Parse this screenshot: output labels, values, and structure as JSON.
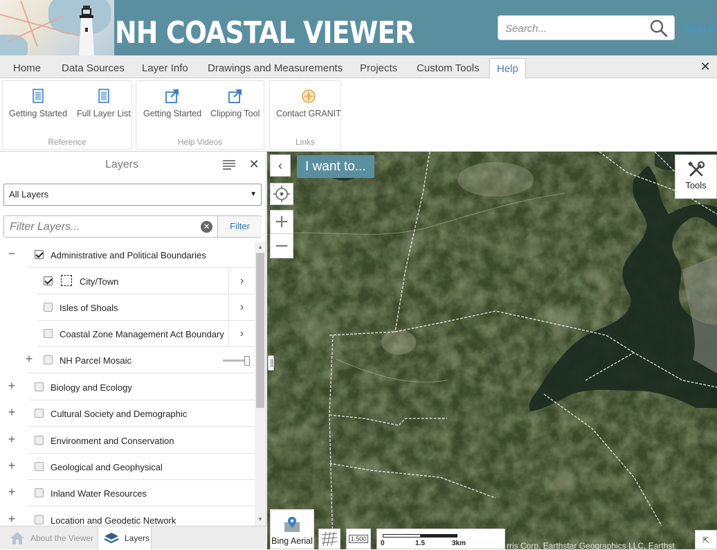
{
  "header": {
    "title": "NH COASTAL VIEWER",
    "search_placeholder": "Search...",
    "sign_in": "Sign in"
  },
  "ribbon": {
    "tabs": [
      {
        "label": "Home",
        "active": false
      },
      {
        "label": "Data Sources",
        "active": false
      },
      {
        "label": "Layer Info",
        "active": false
      },
      {
        "label": "Drawings and Measurements",
        "active": false
      },
      {
        "label": "Projects",
        "active": false
      },
      {
        "label": "Custom Tools",
        "active": false
      },
      {
        "label": "Help",
        "active": true
      }
    ],
    "close_glyph": "✕",
    "groups": [
      {
        "label": "Reference",
        "buttons": [
          {
            "label": "Getting Started",
            "icon": "document-icon"
          },
          {
            "label": "Full Layer List",
            "icon": "document-icon"
          }
        ]
      },
      {
        "label": "Help Videos",
        "buttons": [
          {
            "label": "Getting Started",
            "icon": "external-link-icon"
          },
          {
            "label": "Clipping Tool",
            "icon": "external-link-icon"
          }
        ]
      },
      {
        "label": "Links",
        "buttons": [
          {
            "label": "Contact GRANIT",
            "icon": "compass-icon"
          }
        ]
      }
    ]
  },
  "layers_panel": {
    "title": "Layers",
    "close_glyph": "✕",
    "select_value": "All Layers",
    "select_arrow": "▼",
    "filter_placeholder": "Filter Layers...",
    "filter_clear": "✕",
    "filter_button": "Filter",
    "rows": [
      {
        "label": "Administrative and Political Boundaries",
        "expander": "−",
        "checked": true,
        "level": 0
      },
      {
        "label": "City/Town",
        "checked": true,
        "level": 1,
        "chevron": "›",
        "swatch": true
      },
      {
        "label": "Isles of Shoals",
        "checked": false,
        "level": 1,
        "chevron": "›"
      },
      {
        "label": "Coastal Zone Management Act Boundary",
        "checked": false,
        "level": 1,
        "chevron": "›"
      },
      {
        "label": "NH Parcel Mosaic",
        "expander": "+",
        "checked": false,
        "level": 1,
        "slider": 0.95
      },
      {
        "label": "Biology and Ecology",
        "expander": "+",
        "checked": false,
        "level": 0
      },
      {
        "label": "Cultural Society and Demographic",
        "expander": "+",
        "checked": false,
        "level": 0
      },
      {
        "label": "Environment and Conservation",
        "expander": "+",
        "checked": false,
        "level": 0
      },
      {
        "label": "Geological and Geophysical",
        "expander": "+",
        "checked": false,
        "level": 0
      },
      {
        "label": "Inland Water Resources",
        "expander": "+",
        "checked": false,
        "level": 0
      },
      {
        "label": "Location and Geodetic Network",
        "expander": "+",
        "checked": false,
        "level": 0
      }
    ],
    "footer_tabs": [
      {
        "label": "About the Viewer",
        "icon": "home-icon",
        "active": false
      },
      {
        "label": "Layers",
        "icon": "layers-icon",
        "active": true
      }
    ]
  },
  "map": {
    "collapse_glyph": "‹",
    "i_want_to": "I want to...",
    "zoom_in": "+",
    "zoom_out": "−",
    "tools_label": "Tools",
    "basemap_label": "Bing Aerial",
    "scale_label": "1:500",
    "scale_ticks": [
      "0",
      "1.5",
      "3km"
    ],
    "attribution": "rris Corp, Earthstar Geographics LLC, Earthst",
    "expand_glyph": "⇱"
  },
  "colors": {
    "header_bg": "#5a8fa0",
    "accent_blue": "#3a7fc1",
    "link_blue": "#3a9ad9"
  }
}
